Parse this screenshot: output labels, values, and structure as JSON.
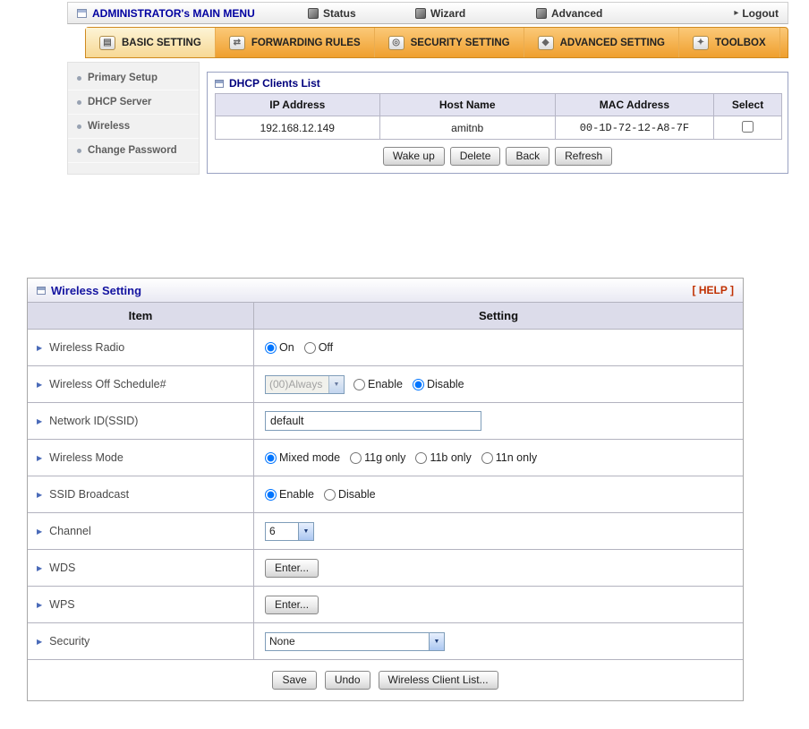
{
  "menubar": {
    "title": "ADMINISTRATOR's MAIN MENU",
    "items": [
      {
        "label": "Status"
      },
      {
        "label": "Wizard"
      },
      {
        "label": "Advanced"
      }
    ],
    "logout": "Logout"
  },
  "icons": {
    "logout_arrow": "▸",
    "dropdown_arrow": "▼",
    "row_bullet": "▶",
    "tab_basic": "▤",
    "tab_forwarding": "⇄",
    "tab_security": "◎",
    "tab_advanced": "◆",
    "tab_toolbox": "✦"
  },
  "tabs": [
    {
      "label": "BASIC SETTING",
      "active": true
    },
    {
      "label": "FORWARDING RULES",
      "active": false
    },
    {
      "label": "SECURITY SETTING",
      "active": false
    },
    {
      "label": "ADVANCED SETTING",
      "active": false
    },
    {
      "label": "TOOLBOX",
      "active": false
    }
  ],
  "sidebar": [
    {
      "label": "Primary Setup"
    },
    {
      "label": "DHCP Server"
    },
    {
      "label": "Wireless"
    },
    {
      "label": "Change Password"
    }
  ],
  "dhcp": {
    "title": "DHCP Clients List",
    "headers": [
      "IP Address",
      "Host Name",
      "MAC Address",
      "Select"
    ],
    "row": {
      "ip": "192.168.12.149",
      "host": "amitnb",
      "mac": "00-1D-72-12-A8-7F",
      "selected": false
    },
    "buttons": {
      "wakeup": "Wake up",
      "delete": "Delete",
      "back": "Back",
      "refresh": "Refresh"
    }
  },
  "wireless": {
    "title": "Wireless Setting",
    "help": "[ HELP ]",
    "col_item": "Item",
    "col_setting": "Setting",
    "rows": {
      "radio": {
        "label": "Wireless Radio",
        "on": "On",
        "off": "Off",
        "selected": "On"
      },
      "schedule": {
        "label": "Wireless Off Schedule#",
        "select": "(00)Always",
        "enable": "Enable",
        "disable": "Disable",
        "selected": "Disable"
      },
      "ssid": {
        "label": "Network ID(SSID)",
        "value": "default"
      },
      "mode": {
        "label": "Wireless Mode",
        "options": [
          "Mixed mode",
          "11g only",
          "11b only",
          "11n only"
        ],
        "selected": "Mixed mode"
      },
      "broadcast": {
        "label": "SSID Broadcast",
        "enable": "Enable",
        "disable": "Disable",
        "selected": "Enable"
      },
      "channel": {
        "label": "Channel",
        "value": "6"
      },
      "wds": {
        "label": "WDS",
        "button": "Enter..."
      },
      "wps": {
        "label": "WPS",
        "button": "Enter..."
      },
      "security": {
        "label": "Security",
        "value": "None"
      }
    },
    "buttons": {
      "save": "Save",
      "undo": "Undo",
      "client_list": "Wireless Client List..."
    }
  }
}
